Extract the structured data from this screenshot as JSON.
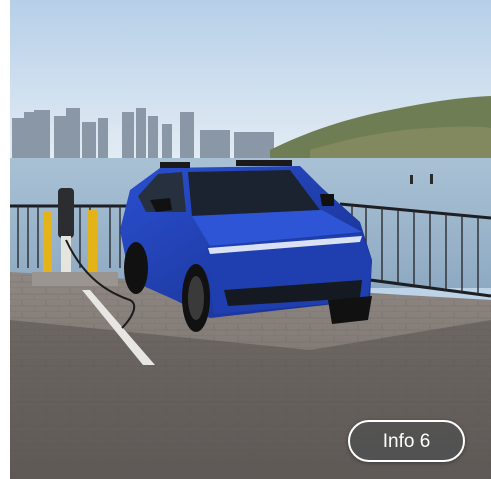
{
  "gallery": {
    "info_button_label": "Info 6"
  },
  "colors": {
    "vehicle": "#1f3fb0",
    "sky": "#c9dcf0",
    "water": "#9fbad1",
    "pavement": "#7a7570"
  },
  "icons": {
    "charger": "ev-charger-icon"
  }
}
